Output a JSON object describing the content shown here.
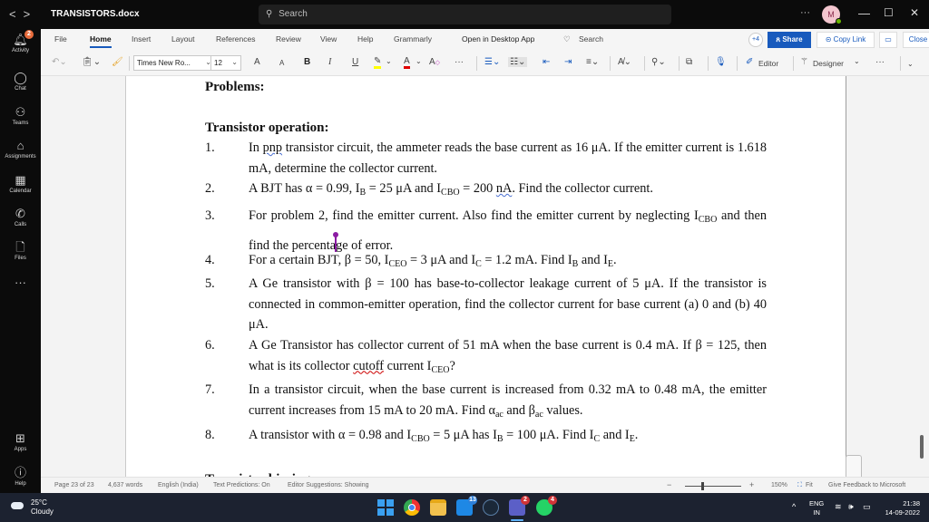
{
  "titlebar": {
    "back_icon": "chevron-left",
    "forward_icon": "chevron-right",
    "title": "TRANSISTORS.docx",
    "search_placeholder": "Search",
    "more_label": "···",
    "avatar_initial": "M",
    "minimize": "—",
    "maximize": "☐",
    "close": "✕"
  },
  "rail": {
    "items": [
      {
        "label": "Activity",
        "icon": "bell-icon",
        "badge": "2"
      },
      {
        "label": "Chat",
        "icon": "chat-icon"
      },
      {
        "label": "Teams",
        "icon": "teams-icon"
      },
      {
        "label": "Assignments",
        "icon": "backpack-icon"
      },
      {
        "label": "Calendar",
        "icon": "calendar-icon"
      },
      {
        "label": "Calls",
        "icon": "phone-icon"
      },
      {
        "label": "Files",
        "icon": "file-icon"
      },
      {
        "label": "···",
        "icon": "more-icon"
      },
      {
        "label": "Apps",
        "icon": "apps-icon"
      },
      {
        "label": "Help",
        "icon": "help-icon"
      }
    ]
  },
  "ribbon": {
    "tabs": [
      "File",
      "Home",
      "Insert",
      "Layout",
      "References",
      "Review",
      "View",
      "Help",
      "Grammarly",
      "Open in Desktop App",
      "Search"
    ],
    "active_tab": "Home",
    "participants_badge": "+4",
    "share_label": "Share",
    "copy_link_label": "Copy Link",
    "close_label": "Close",
    "more_label": "···",
    "font_name": "Times New Ro...",
    "font_size": "12",
    "tools": {
      "grow_font": "A",
      "shrink_font": "A",
      "bold": "B",
      "italic": "I",
      "underline": "U",
      "editor_label": "Editor",
      "designer_label": "Designer",
      "more": "···"
    },
    "colors": {
      "accent": "#185abd",
      "highlight": "#ffff00",
      "font_color": "#e00000"
    }
  },
  "document": {
    "heading_problems": "Problems:",
    "heading_section": "Transistor operation:",
    "next_heading": "Transistor biasing",
    "questions": [
      {
        "num": "1."
      },
      {
        "num": "2."
      },
      {
        "num": "3."
      },
      {
        "num": "4."
      },
      {
        "num": "5."
      },
      {
        "num": "6."
      },
      {
        "num": "7."
      },
      {
        "num": "8."
      }
    ],
    "text": {
      "q1a": "In ",
      "q1b": "pnp",
      "q1c": " transistor circuit, the ammeter reads the base current as 16 μA.  If the emitter current is 1.618 mA, determine the collector current.",
      "q2a": "A BJT has α = 0.99, I",
      "q2b": "B",
      "q2c": " = 25 μA and I",
      "q2d": "CBO",
      "q2e": " = 200 ",
      "q2f": "nA",
      "q2g": ".  Find the collector current.",
      "q3a": "For problem 2, find the emitter current.  Also find the emitter current by neglecting I",
      "q3b": "CBO",
      "q3c": " and then find the percenta",
      "q3d": "ge of error.",
      "q4a": "For a certain BJT, β = 50, I",
      "q4b": "CEO",
      "q4c": " = 3 μA and I",
      "q4d": "C",
      "q4e": " = 1.2 mA.  Find I",
      "q4f": "B",
      "q4g": " and I",
      "q4h": "E",
      "q4i": ".",
      "q5": "A Ge transistor with β = 100 has base-to-collector leakage current of 5 μA.  If the transistor is connected in common-emitter operation, find the collector current for base current (a) 0 and (b) 40 μA.",
      "q6a": "A Ge Transistor has collector current of 51 mA when the base current is 0.4 mA.  If β = 125, then what is its collector ",
      "q6b": "cutoff",
      "q6c": " current I",
      "q6d": "CEO",
      "q6e": "?",
      "q7a": "In a transistor circuit, when the base current is increased from 0.32 mA to 0.48 mA, the emitter current increases from 15 mA to 20 mA.  Find α",
      "q7b": "ac",
      "q7c": " and β",
      "q7d": "ac",
      "q7e": " values.",
      "q8a": "A transistor with α = 0.98 and I",
      "q8b": "CBO",
      "q8c": " = 5 μA has I",
      "q8d": "B",
      "q8e": " = 100 μA.  Find I",
      "q8f": "C",
      "q8g": " and I",
      "q8h": "E",
      "q8i": "."
    }
  },
  "statusbar": {
    "page": "Page 23 of 23",
    "words": "4,637 words",
    "language": "English (India)",
    "text_predictions": "Text Predictions: On",
    "editor_suggestions": "Editor Suggestions: Showing",
    "zoom_minus": "−",
    "zoom_plus": "+",
    "zoom_level": "150%",
    "fit_label": "Fit",
    "feedback": "Give Feedback to Microsoft"
  },
  "taskbar": {
    "temperature": "25°C",
    "condition": "Cloudy",
    "apps": [
      {
        "name": "start",
        "badge": ""
      },
      {
        "name": "chrome",
        "badge": ""
      },
      {
        "name": "file-explorer",
        "badge": ""
      },
      {
        "name": "mail",
        "badge": "13"
      },
      {
        "name": "steam",
        "badge": ""
      },
      {
        "name": "teams",
        "badge": "2"
      },
      {
        "name": "whatsapp",
        "badge": "4"
      }
    ],
    "lang_line1": "ENG",
    "lang_line2": "IN",
    "time": "21:38",
    "date": "14-09-2022",
    "chevron": "^"
  }
}
